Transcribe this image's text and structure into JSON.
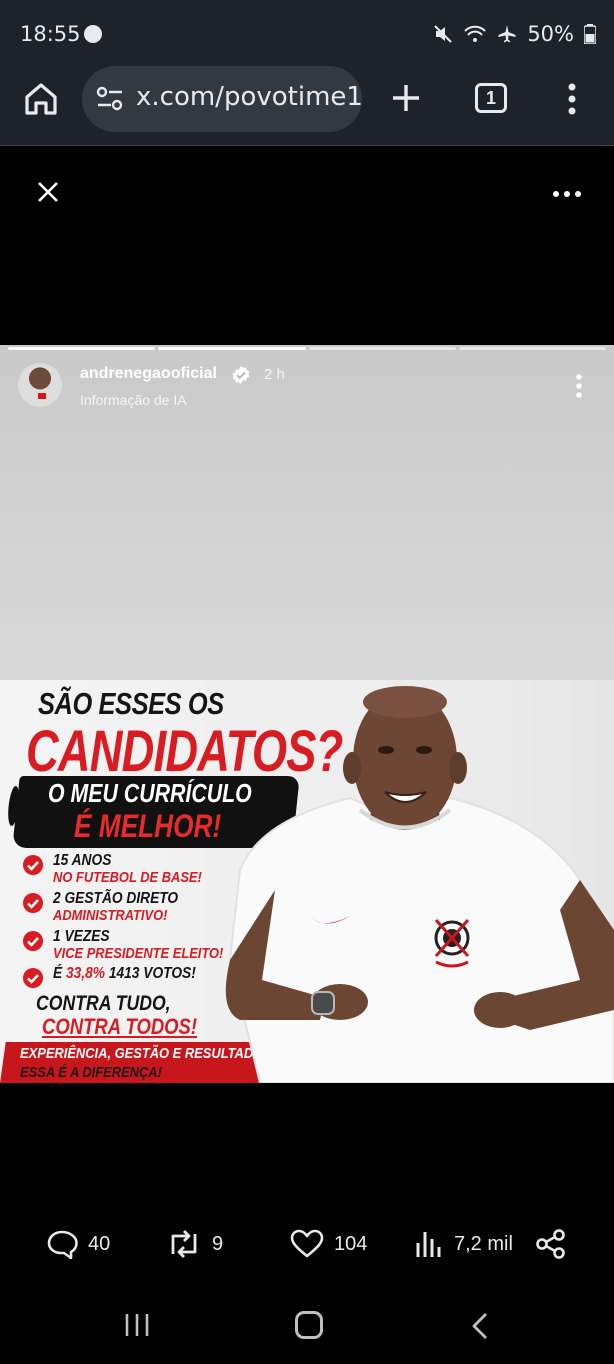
{
  "status_bar": {
    "time": "18:55",
    "battery": "50%"
  },
  "browser": {
    "url": "x.com/povotime1",
    "tab_count": "1"
  },
  "story": {
    "username": "andrenegaooficial",
    "time_ago": "2 h",
    "ai_label": "Informação de IA",
    "progress_segments": 4,
    "progress_done": 2
  },
  "poster": {
    "headline_line1": "SÃO ESSES OS",
    "headline_line2": "CANDIDATOS?",
    "curriculum_line1": "O MEU CURRÍCULO",
    "curriculum_line2": "É MELHOR!",
    "bullets": [
      {
        "line1": "15 ANOS",
        "line2": "NO FUTEBOL DE BASE!"
      },
      {
        "line1": "2 GESTÃO DIRETO",
        "line2": "ADMINISTRATIVO!"
      },
      {
        "line1": "1 VEZES",
        "line2": "VICE PRESIDENTE ELEITO!"
      },
      {
        "line1_prefix": "É ",
        "line1_red": "33,8%",
        "line1_suffix": " 1413 VOTOS!"
      }
    ],
    "contra_line1": "CONTRA TUDO,",
    "contra_line2": "CONTRA TODOS!",
    "banner_line1": "EXPERIÊNCIA, GESTÃO E RESULTADO!",
    "banner_line2": "ESSA É A DIFERENÇA!"
  },
  "actions": {
    "replies": "40",
    "reposts": "9",
    "likes": "104",
    "views": "7,2 mil"
  },
  "colors": {
    "brand_red": "#d91b22",
    "status_bg": "#1e2329",
    "url_pill_bg": "#333940",
    "verified_badge": "#ffffff"
  },
  "icons": [
    "home-icon",
    "site-info-icon",
    "plus-icon",
    "tabs-icon",
    "more-vert-icon",
    "close-icon",
    "more-horiz-icon",
    "verified-icon",
    "reply-icon",
    "repost-icon",
    "like-icon",
    "views-icon",
    "share-icon",
    "recents-icon",
    "nav-home-icon",
    "back-icon"
  ]
}
